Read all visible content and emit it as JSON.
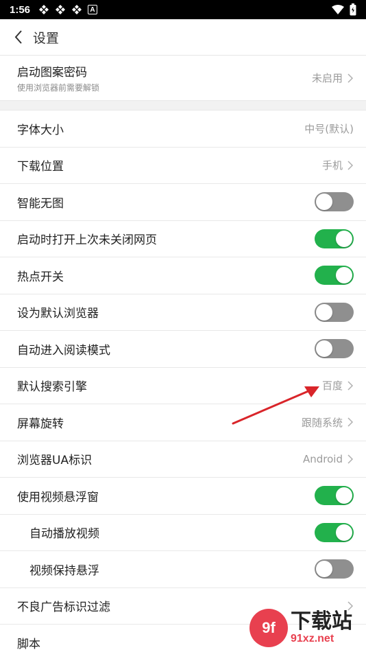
{
  "status": {
    "time": "1:56",
    "indicator": "A"
  },
  "header": {
    "title": "设置"
  },
  "pattern_lock": {
    "label": "启动图案密码",
    "subtitle": "使用浏览器前需要解锁",
    "value": "未启用"
  },
  "settings": [
    {
      "label": "字体大小",
      "value": "中号(默认)"
    },
    {
      "label": "下载位置",
      "value": "手机"
    },
    {
      "label": "智能无图",
      "toggle": "off"
    },
    {
      "label": "启动时打开上次未关闭网页",
      "toggle": "on"
    },
    {
      "label": "热点开关",
      "toggle": "on"
    },
    {
      "label": "设为默认浏览器",
      "toggle": "off"
    },
    {
      "label": "自动进入阅读模式",
      "toggle": "off"
    },
    {
      "label": "默认搜索引擎",
      "value": "百度"
    },
    {
      "label": "屏幕旋转",
      "value": "跟随系统"
    },
    {
      "label": "浏览器UA标识",
      "value": "Android"
    },
    {
      "label": "使用视频悬浮窗",
      "toggle": "on"
    },
    {
      "label": "自动播放视频",
      "toggle": "on"
    },
    {
      "label": "视频保持悬浮",
      "toggle": "off"
    },
    {
      "label": "不良广告标识过滤"
    },
    {
      "label": "脚本"
    }
  ],
  "colors": {
    "toggle_on": "#22b14c",
    "toggle_off": "#8f8f8f",
    "annotation": "#d9252a"
  },
  "watermark": {
    "logo": "9f",
    "title": "下载站",
    "url": "91xz.net"
  }
}
